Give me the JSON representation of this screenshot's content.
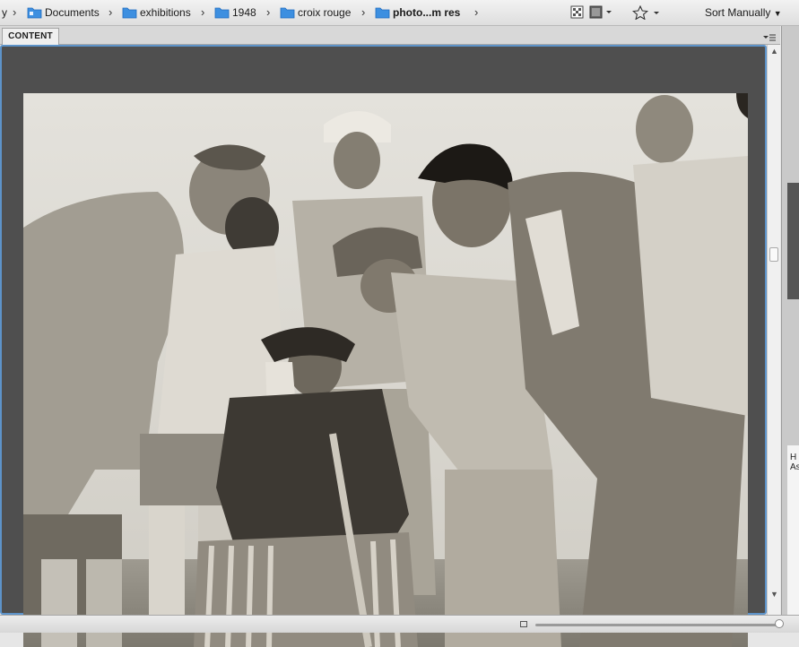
{
  "breadcrumb": {
    "leading": "y",
    "items": [
      {
        "label": "Documents",
        "icon": "folder-icon"
      },
      {
        "label": "exhibitions",
        "icon": "folder-icon"
      },
      {
        "label": "1948",
        "icon": "folder-icon"
      },
      {
        "label": "croix rouge",
        "icon": "folder-icon"
      },
      {
        "label": "photo...m res",
        "icon": "folder-icon"
      }
    ]
  },
  "toolbar": {
    "sort_label": "Sort Manually"
  },
  "panel": {
    "tab_label": "CONTENT"
  },
  "right_panel": {
    "meta_text_1": "H",
    "meta_text_2": "As"
  },
  "colors": {
    "accent": "#5d93c9",
    "folder": "#3d8fe0",
    "viewer_bg": "#4f4f4f"
  }
}
